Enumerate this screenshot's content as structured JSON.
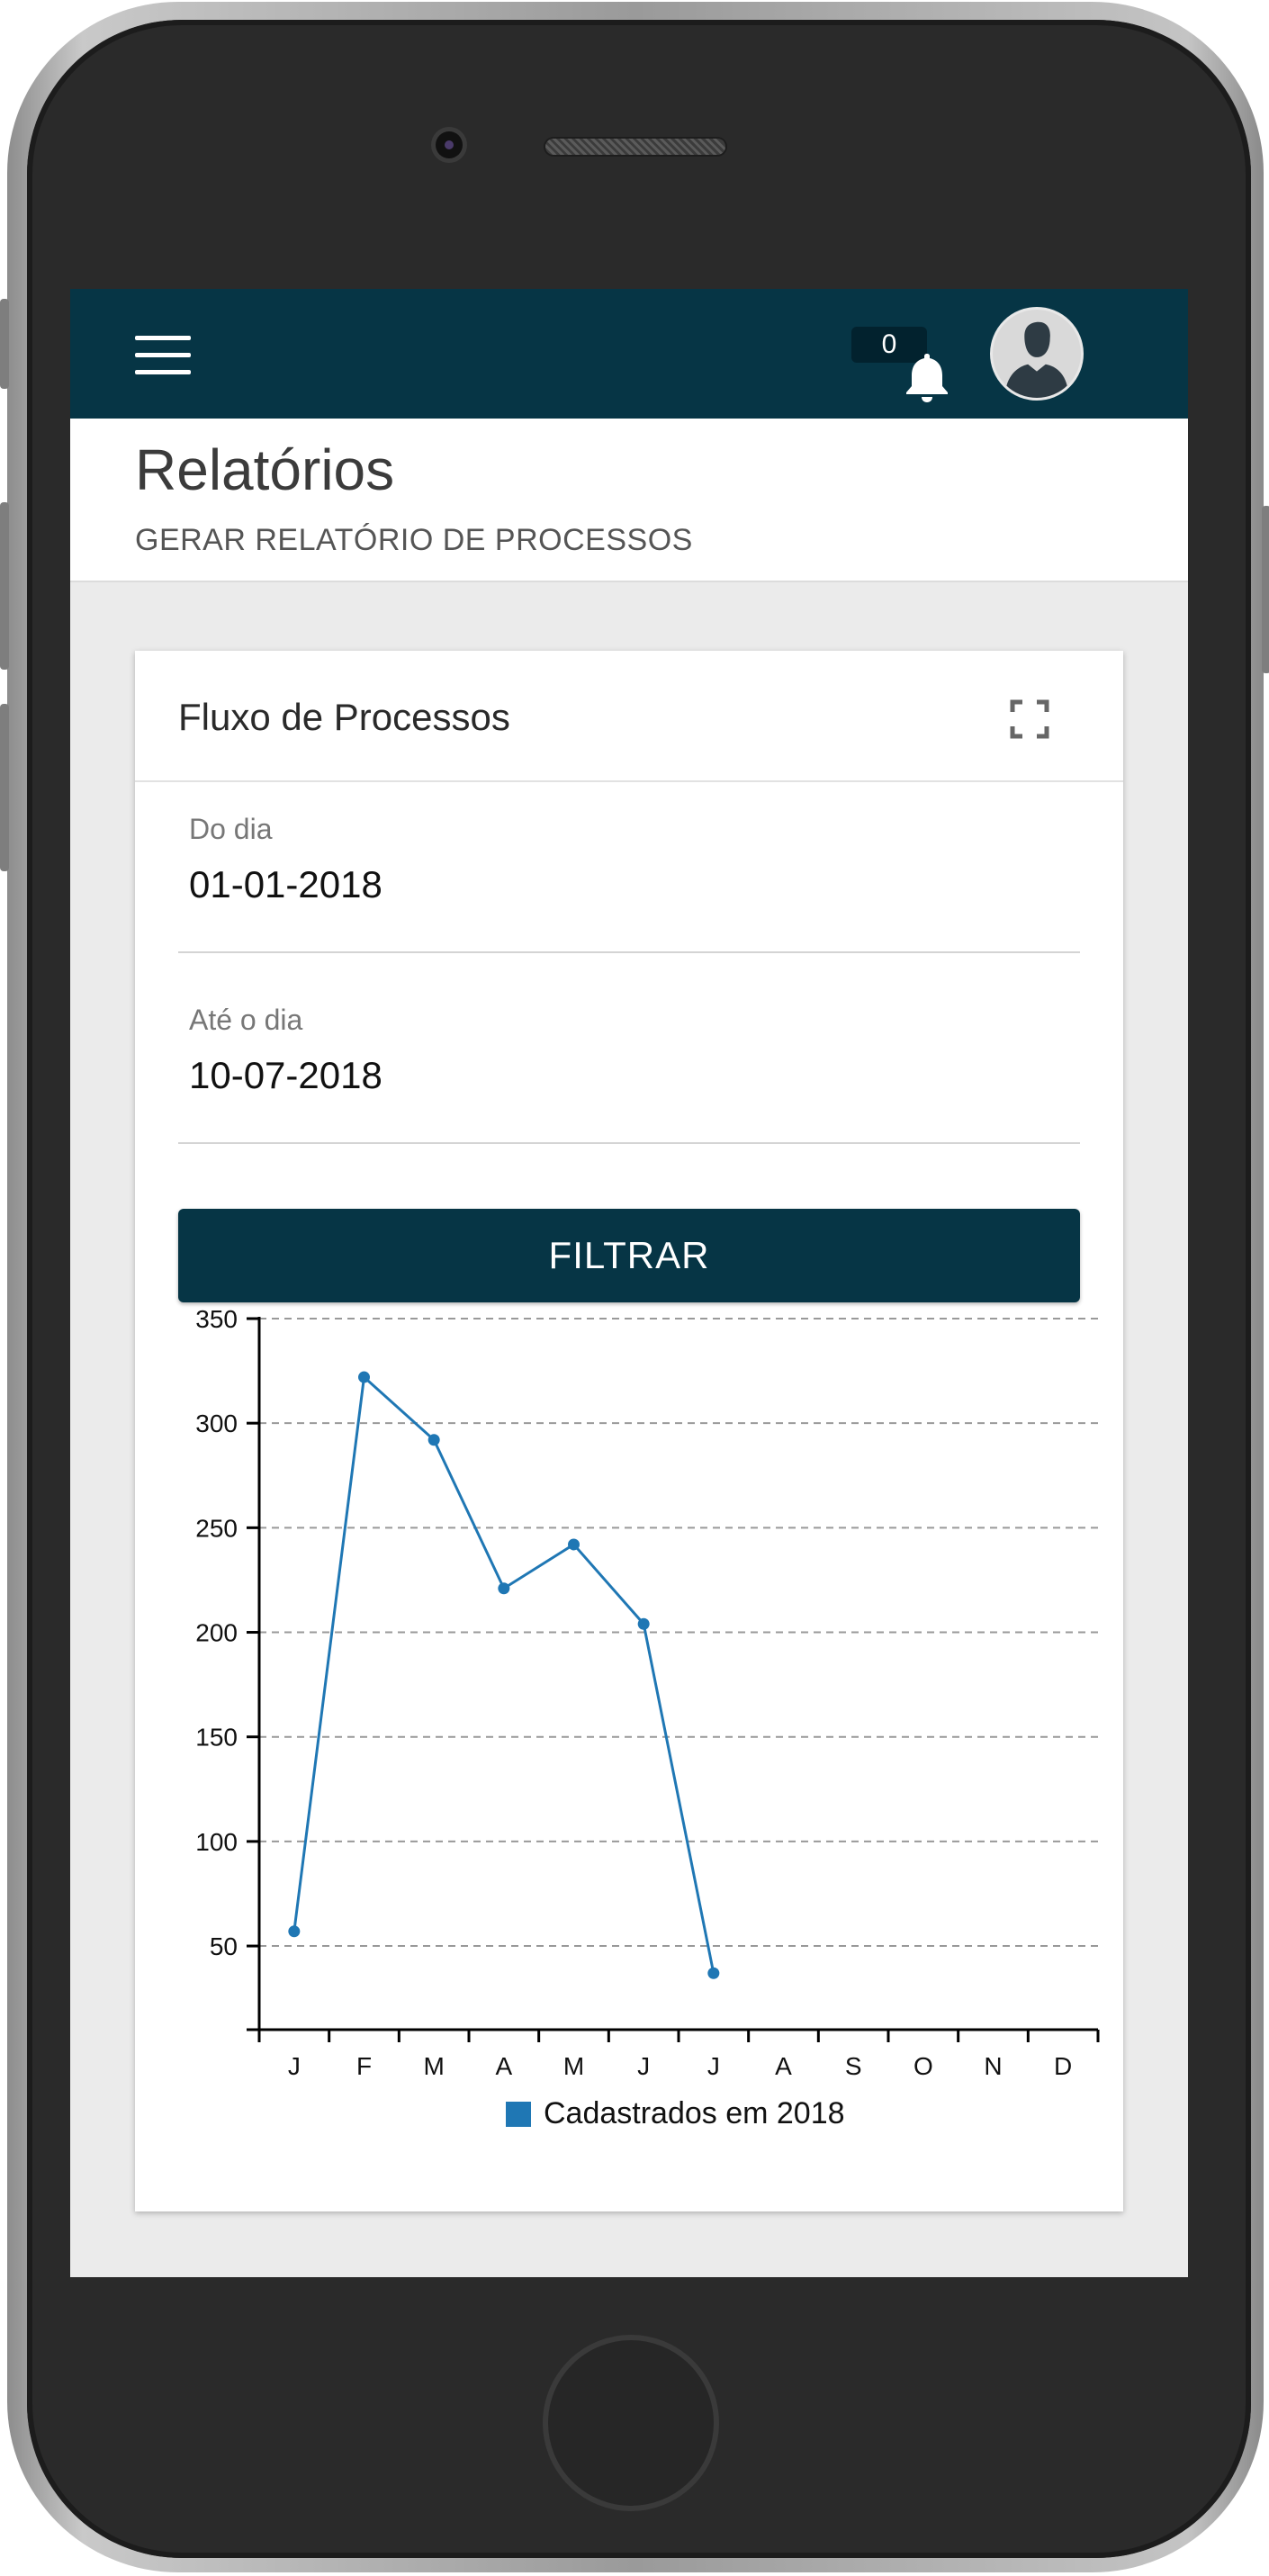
{
  "topbar": {
    "notification_count": "0",
    "colors": {
      "bar": "#063545",
      "badge": "#02222e"
    }
  },
  "header": {
    "title": "Relatórios",
    "subtitle": "GERAR RELATÓRIO DE PROCESSOS"
  },
  "card": {
    "title": "Fluxo de Processos",
    "from_label": "Do dia",
    "from_value": "01-01-2018",
    "to_label": "Até o dia",
    "to_value": "10-07-2018",
    "filter_label": "FILTRAR"
  },
  "icons": [
    "menu-icon",
    "bell-icon",
    "user-avatar-icon",
    "expand-icon"
  ],
  "chart_data": {
    "type": "line",
    "categories": [
      "J",
      "F",
      "M",
      "A",
      "M",
      "J",
      "J",
      "A",
      "S",
      "O",
      "N",
      "D"
    ],
    "series": [
      {
        "name": "Cadastrados em 2018",
        "color": "#1f77b4",
        "values": [
          57,
          322,
          292,
          221,
          242,
          204,
          37,
          null,
          null,
          null,
          null,
          null
        ]
      }
    ],
    "yticks": [
      50,
      100,
      150,
      200,
      250,
      300,
      350
    ],
    "ylim": [
      10,
      350
    ],
    "grid": "horizontal-dashed",
    "legend": "bottom-center",
    "title": "",
    "xlabel": "",
    "ylabel": ""
  }
}
